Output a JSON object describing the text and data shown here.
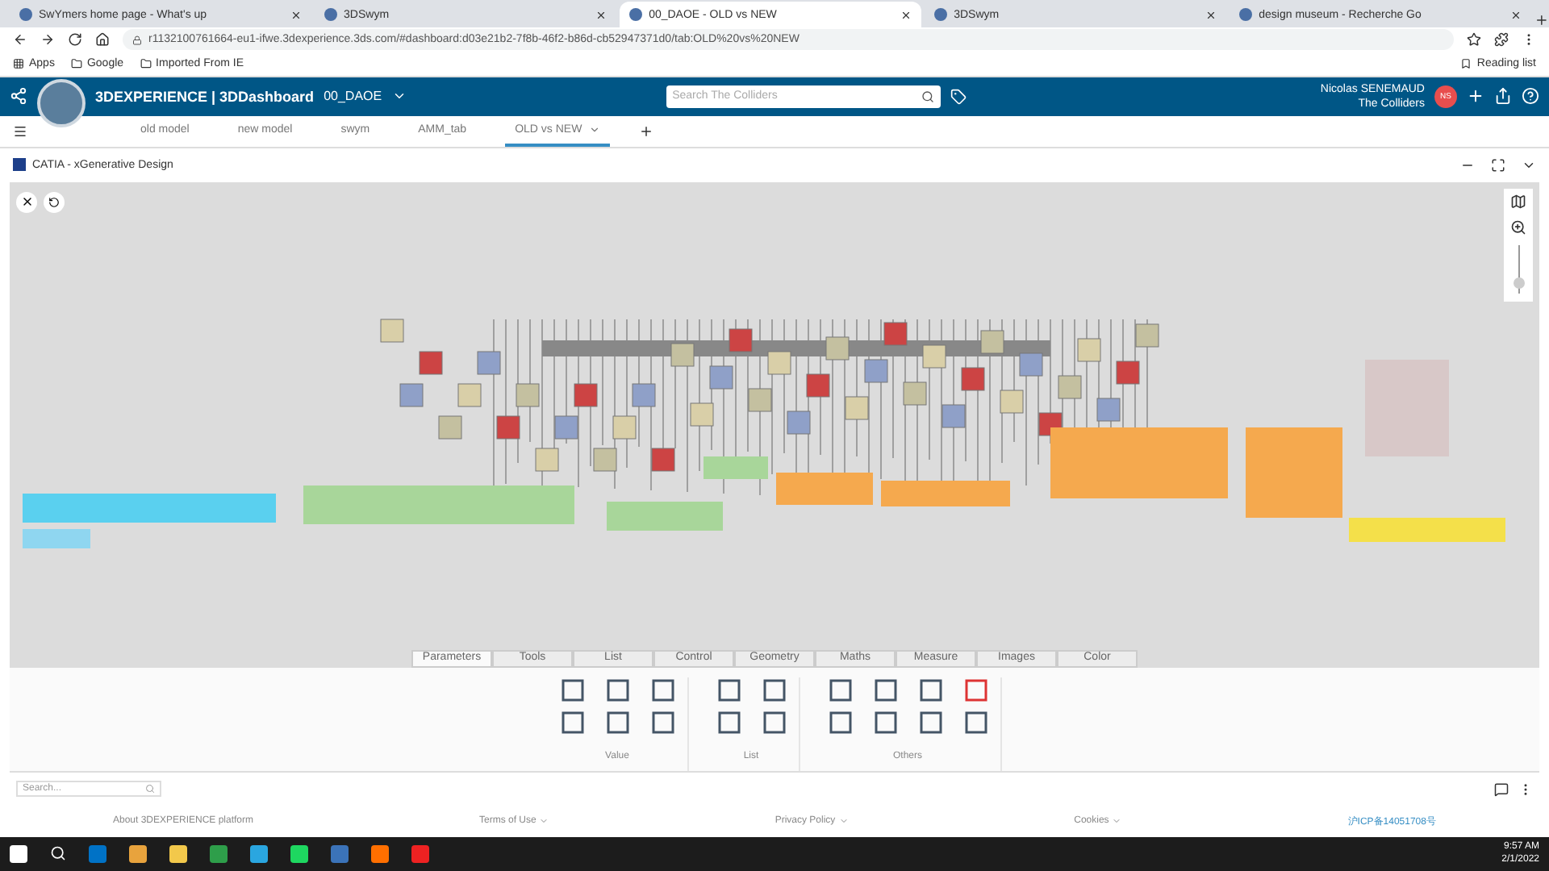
{
  "browser": {
    "tabs": [
      {
        "title": "SwYmers home page - What's up",
        "selected": false
      },
      {
        "title": "3DSwym",
        "selected": false
      },
      {
        "title": "00_DAOE - OLD vs NEW",
        "selected": true
      },
      {
        "title": "3DSwym",
        "selected": false
      },
      {
        "title": "design museum - Recherche Go",
        "selected": false
      }
    ],
    "url": "r1132100761664-eu1-ifwe.3dexperience.3ds.com/#dashboard:d03e21b2-7f8b-46f2-b86d-cb52947371d0/tab:OLD%20vs%20NEW",
    "bookmarks": [
      "Apps",
      "Google",
      "Imported From IE"
    ],
    "reading_list": "Reading list"
  },
  "app": {
    "brand": "3DEXPERIENCE | 3DDashboard",
    "dashboard": "00_DAOE",
    "search_placeholder": "Search The Colliders",
    "user": "Nicolas SENEMAUD",
    "community": "The Colliders",
    "avatar": "NS"
  },
  "dashboard_tabs": [
    {
      "label": "old model",
      "selected": false
    },
    {
      "label": "new model",
      "selected": false
    },
    {
      "label": "swym",
      "selected": false
    },
    {
      "label": "AMM_tab",
      "selected": false
    },
    {
      "label": "OLD vs NEW",
      "selected": true
    }
  ],
  "widget": {
    "title": "CATIA - xGenerative Design",
    "zoom": {
      "level": 0.1
    }
  },
  "tool_tabs": [
    {
      "label": "Parameters",
      "selected": true
    },
    {
      "label": "Tools",
      "selected": false
    },
    {
      "label": "List",
      "selected": false
    },
    {
      "label": "Control",
      "selected": false
    },
    {
      "label": "Geometry",
      "selected": false
    },
    {
      "label": "Maths",
      "selected": false
    },
    {
      "label": "Measure",
      "selected": false
    },
    {
      "label": "Images",
      "selected": false
    },
    {
      "label": "Color",
      "selected": false
    }
  ],
  "tool_groups": [
    "Value",
    "List",
    "Others"
  ],
  "search_placeholder": "Search...",
  "footer": [
    "About 3DEXPERIENCE platform",
    "Terms of Use",
    "Privacy Policy",
    "Cookies"
  ],
  "footer_link": "沪ICP备14051708号",
  "clock": {
    "time": "9:57 AM",
    "date": "2/1/2022"
  }
}
